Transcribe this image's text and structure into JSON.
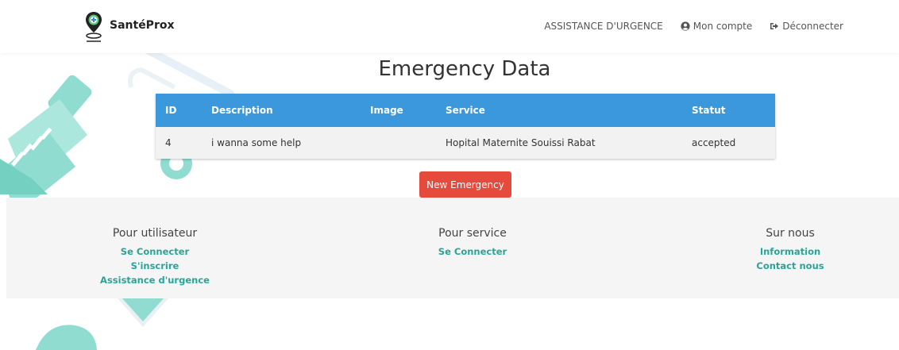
{
  "navbar": {
    "brand": "SantéProx",
    "links": {
      "emergency": "ASSISTANCE D'URGENCE",
      "account": "Mon compte",
      "logout": "Déconnecter"
    }
  },
  "main": {
    "title": "Emergency Data",
    "table": {
      "headers": [
        "ID",
        "Description",
        "Image",
        "Service",
        "Statut"
      ],
      "rows": [
        {
          "id": "4",
          "description": "i wanna some help",
          "image": "",
          "service": "Hopital Maternite Souissi Rabat",
          "status": "accepted"
        }
      ]
    },
    "new_button": "New Emergency"
  },
  "footer": {
    "user": {
      "title": "Pour utilisateur",
      "links": [
        "Se Connecter",
        "S'inscrire",
        "Assistance d'urgence"
      ]
    },
    "service": {
      "title": "Pour service",
      "links": [
        "Se Connecter"
      ]
    },
    "about": {
      "title": "Sur nous",
      "links": [
        "Information",
        "Contact nous"
      ]
    }
  },
  "colors": {
    "header_blue": "#3b98dc",
    "button_red": "#e54a3c",
    "link_teal": "#26a69a",
    "deco_teal": "#7ed6c9"
  }
}
